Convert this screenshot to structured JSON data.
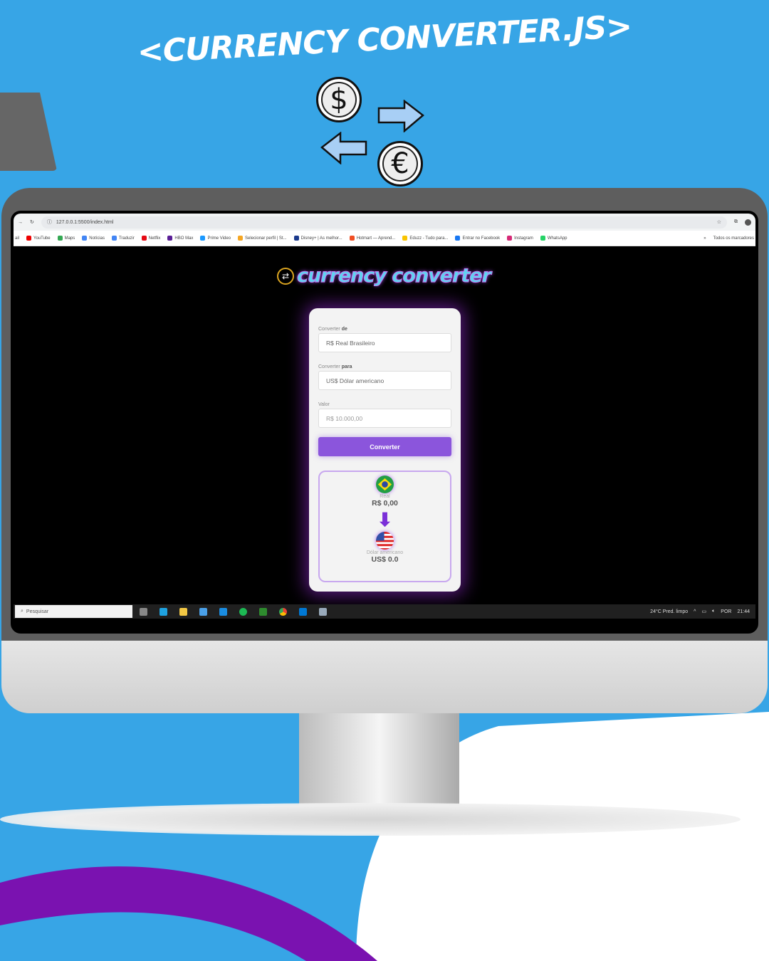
{
  "promo": {
    "headline": "<CURRENCY CONVERTER.JS>",
    "coin_dollar": "$",
    "coin_euro": "€"
  },
  "browser": {
    "url": "127.0.0.1:5500/index.html",
    "bookmarks": [
      {
        "label": "ail",
        "color": "#999"
      },
      {
        "label": "YouTube",
        "color": "#e00"
      },
      {
        "label": "Maps",
        "color": "#34a853"
      },
      {
        "label": "Notícias",
        "color": "#4285f4"
      },
      {
        "label": "Traduzir",
        "color": "#4285f4"
      },
      {
        "label": "Netflix",
        "color": "#e50914"
      },
      {
        "label": "HBO Max",
        "color": "#5a1e96"
      },
      {
        "label": "Prime Video",
        "color": "#1a98ff"
      },
      {
        "label": "Selecionar perfil | St...",
        "color": "#f5a623"
      },
      {
        "label": "Disney+ | As melhor...",
        "color": "#1b3a8c"
      },
      {
        "label": "Hotmart — Aprend...",
        "color": "#f04e23"
      },
      {
        "label": "Eduzz - Tudo para...",
        "color": "#f9c400"
      },
      {
        "label": "Entrar no Facebook",
        "color": "#1877f2"
      },
      {
        "label": "Instagram",
        "color": "#d62976"
      },
      {
        "label": "WhatsApp",
        "color": "#25d366"
      }
    ],
    "all_bookmarks": "Todos os marcadores"
  },
  "app": {
    "logo_text": "currency converter",
    "from_label": "Converter",
    "from_label_bold": "de",
    "from_value": "R$ Real Brasileiro",
    "to_label": "Converter",
    "to_label_bold": "para",
    "to_value": "US$ Dólar americano",
    "amount_label": "Valor",
    "amount_placeholder": "R$ 10.000,00",
    "convert_button": "Converter",
    "result": {
      "from_name": "Real",
      "from_value": "R$ 0,00",
      "to_name": "Dólar americano",
      "to_value": "US$ 0.0"
    },
    "accent": "#8b55dc"
  },
  "taskbar": {
    "search_placeholder": "Pesquisar",
    "weather": "24°C  Pred. limpo",
    "lang": "POR",
    "time": "21:44"
  }
}
